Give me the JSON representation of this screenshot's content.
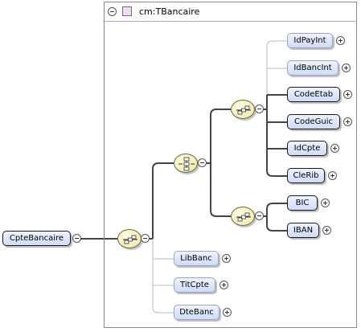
{
  "type_box": {
    "title": "cm:TBancaire"
  },
  "root": {
    "label": "CpteBancaire"
  },
  "elements": {
    "idpayint": "IdPayInt",
    "idbancint": "IdBancInt",
    "codeetab": "CodeEtab",
    "codeguic": "CodeGuic",
    "idcpte": "IdCpte",
    "clerib": "CleRib",
    "bic": "BIC",
    "iban": "IBAN",
    "libbanc": "LibBanc",
    "titcpte": "TitCpte",
    "dtebanc": "DteBanc"
  },
  "icons": {
    "root_sequence": "sequence-compositor-icon",
    "choice": "choice-compositor-icon",
    "upper_sequence": "sequence-compositor-icon",
    "lower_sequence": "sequence-compositor-icon",
    "expand": "plus-circle-icon",
    "collapse": "minus-circle-icon"
  },
  "colors": {
    "element_fill": "#cfdcf7",
    "compositor_fill": "#f5ecb4",
    "required_border": "#1a1a1a",
    "optional_border": "#99a7c6",
    "connector_required": "#444444",
    "connector_optional": "#b8b8b8"
  }
}
